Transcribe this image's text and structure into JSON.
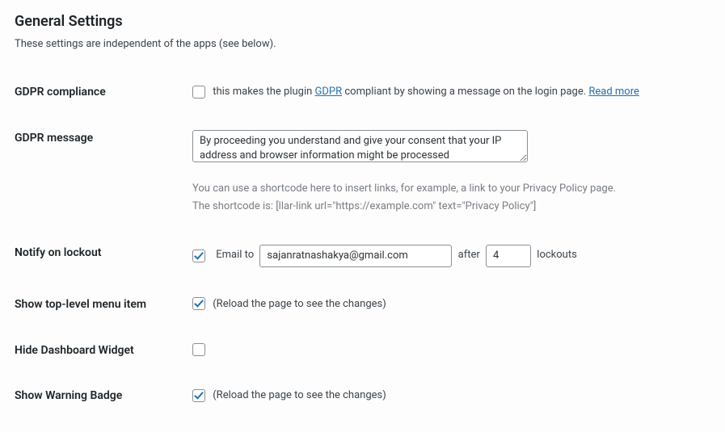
{
  "header": {
    "title": "General Settings",
    "subtitle": "These settings are independent of the apps (see below)."
  },
  "rows": {
    "gdpr_compliance": {
      "label": "GDPR compliance",
      "checked": false,
      "text_before": "this makes the plugin ",
      "link1_text": "GDPR",
      "text_mid": " compliant by showing a message on the login page. ",
      "link2_text": "Read more"
    },
    "gdpr_message": {
      "label": "GDPR message",
      "value": "By proceeding you understand and give your consent that your IP address and browser information might be processed",
      "hint_line1": "You can use a shortcode here to insert links, for example, a link to your Privacy Policy page.",
      "hint_line2": "The shortcode is: [llar-link url=\"https://example.com\" text=\"Privacy Policy\"]"
    },
    "notify": {
      "label": "Notify on lockout",
      "checked": true,
      "email_to_label": "Email to",
      "email_value": "sajanratnashakya@gmail.com",
      "after_label": "after",
      "count_value": "4",
      "lockouts_label": "lockouts"
    },
    "top_menu": {
      "label": "Show top-level menu item",
      "checked": true,
      "note": "(Reload the page to see the changes)"
    },
    "hide_widget": {
      "label": "Hide Dashboard Widget",
      "checked": false
    },
    "warning_badge": {
      "label": "Show Warning Badge",
      "checked": true,
      "note": "(Reload the page to see the changes)"
    }
  }
}
